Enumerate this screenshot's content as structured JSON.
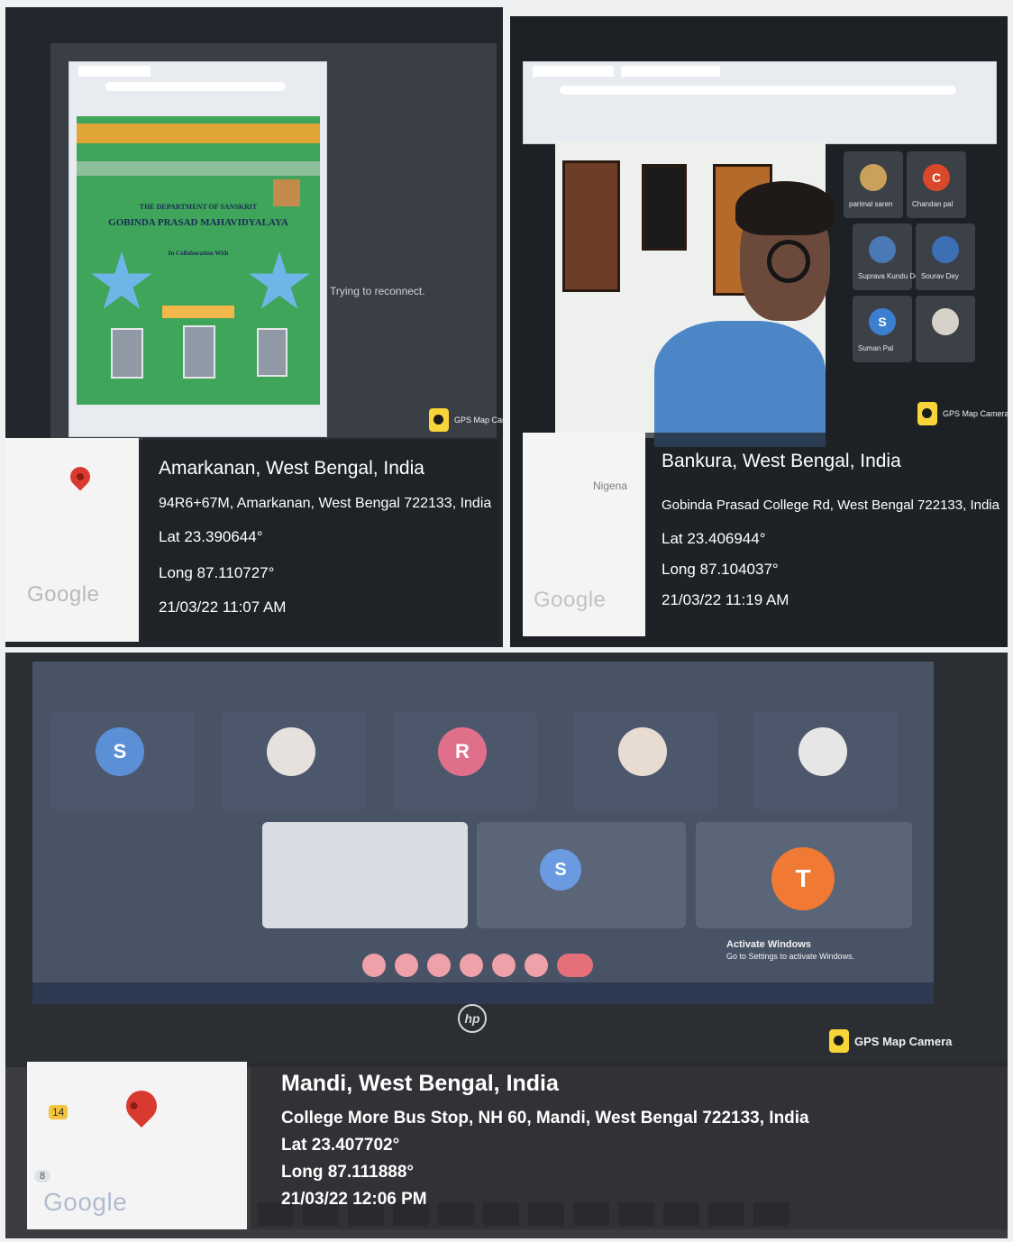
{
  "panels": [
    {
      "gps": {
        "place": "Amarkanan, West Bengal, India",
        "address": "94R6+67M, Amarkanan, West Bengal 722133, India",
        "lat": "Lat 23.390644°",
        "long": "Long 87.110727°",
        "datetime": "21/03/22 11:07 AM"
      },
      "badge": "GPS Map Camera",
      "google": "Google",
      "screen_status": "Trying to reconnect.",
      "poster": {
        "department": "THE DEPARTMENT OF SANSKRIT",
        "college": "GOBINDA PRASAD MAHAVIDYALAYA",
        "collab": "In Collaboration With"
      }
    },
    {
      "gps": {
        "place": "Bankura, West Bengal, India",
        "address": "Gobinda Prasad College Rd, West Bengal 722133, India",
        "lat": "Lat 23.406944°",
        "long": "Long 87.104037°",
        "datetime": "21/03/22 11:19 AM"
      },
      "badge": "GPS Map Camera",
      "google": "Google",
      "map_label": "Nigena",
      "tiles": [
        {
          "initial": "",
          "name": "parimal saren",
          "color": "#c9a15a"
        },
        {
          "initial": "C",
          "name": "Chandan pal",
          "color": "#d9482b"
        },
        {
          "initial": "",
          "name": "Suprava Kundu Dey",
          "color": "#4a79b5"
        },
        {
          "initial": "",
          "name": "Sourav Dey",
          "color": "#3d6fb5"
        },
        {
          "initial": "S",
          "name": "Suman Pal",
          "color": "#3c7fd1"
        },
        {
          "initial": "",
          "name": "",
          "color": "#d7d2c9"
        }
      ]
    },
    {
      "gps": {
        "place": "Mandi, West Bengal, India",
        "address": "College More Bus Stop, NH 60, Mandi, West Bengal 722133, India",
        "lat": "Lat 23.407702°",
        "long": "Long 87.111888°",
        "datetime": "21/03/22 12:06 PM"
      },
      "badge": "GPS Map Camera",
      "google": "Google",
      "map_chip_1": "14",
      "map_chip_2": "8",
      "brand": "hp",
      "activate_title": "Activate Windows",
      "activate_sub": "Go to Settings to activate Windows.",
      "top_row": [
        {
          "initial": "S",
          "color": "#5b8fd6"
        },
        {
          "initial": "",
          "color": "#e6e1dc"
        },
        {
          "initial": "R",
          "color": "#e0708a"
        },
        {
          "initial": "",
          "color": "#e8dcd2"
        },
        {
          "initial": "",
          "color": "#e6e6e6"
        }
      ],
      "bottom_row": [
        {
          "initial": "S",
          "color": "#6a9be0"
        },
        {
          "initial": "T",
          "color": "#f07a33"
        }
      ]
    }
  ]
}
